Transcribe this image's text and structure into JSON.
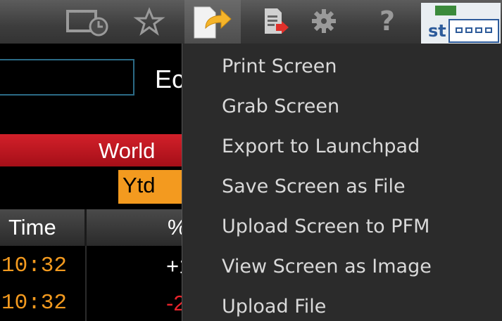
{
  "toolbar": {
    "icons": [
      "monitor-clock-icon",
      "star-icon",
      "export-icon",
      "pdf-icon",
      "gear-icon",
      "help-icon",
      "launchpad-icon"
    ],
    "help_glyph": "?",
    "launchpad_partial_text": "st"
  },
  "terminal": {
    "partial_title": "Ec",
    "section_label": "World",
    "period_label": "Ytd",
    "columns": {
      "time": "Time",
      "pct": "%"
    },
    "rows": [
      {
        "time": "10:32",
        "change": "+1",
        "change_color": "#ffffff"
      },
      {
        "time": "10:32",
        "change": "-2",
        "change_color": "#e8232b"
      }
    ]
  },
  "menu": {
    "items": [
      "Print Screen",
      "Grab Screen",
      "Export to Launchpad",
      "Save Screen as File",
      "Upload Screen to PFM",
      "View Screen as Image",
      "Upload File"
    ]
  },
  "colors": {
    "toolbar_bg": "#3d3d3d",
    "menu_bg": "#2b2b2b",
    "menu_text": "#d9d9d9",
    "accent_orange": "#f39a1f",
    "accent_red": "#d2202a"
  }
}
